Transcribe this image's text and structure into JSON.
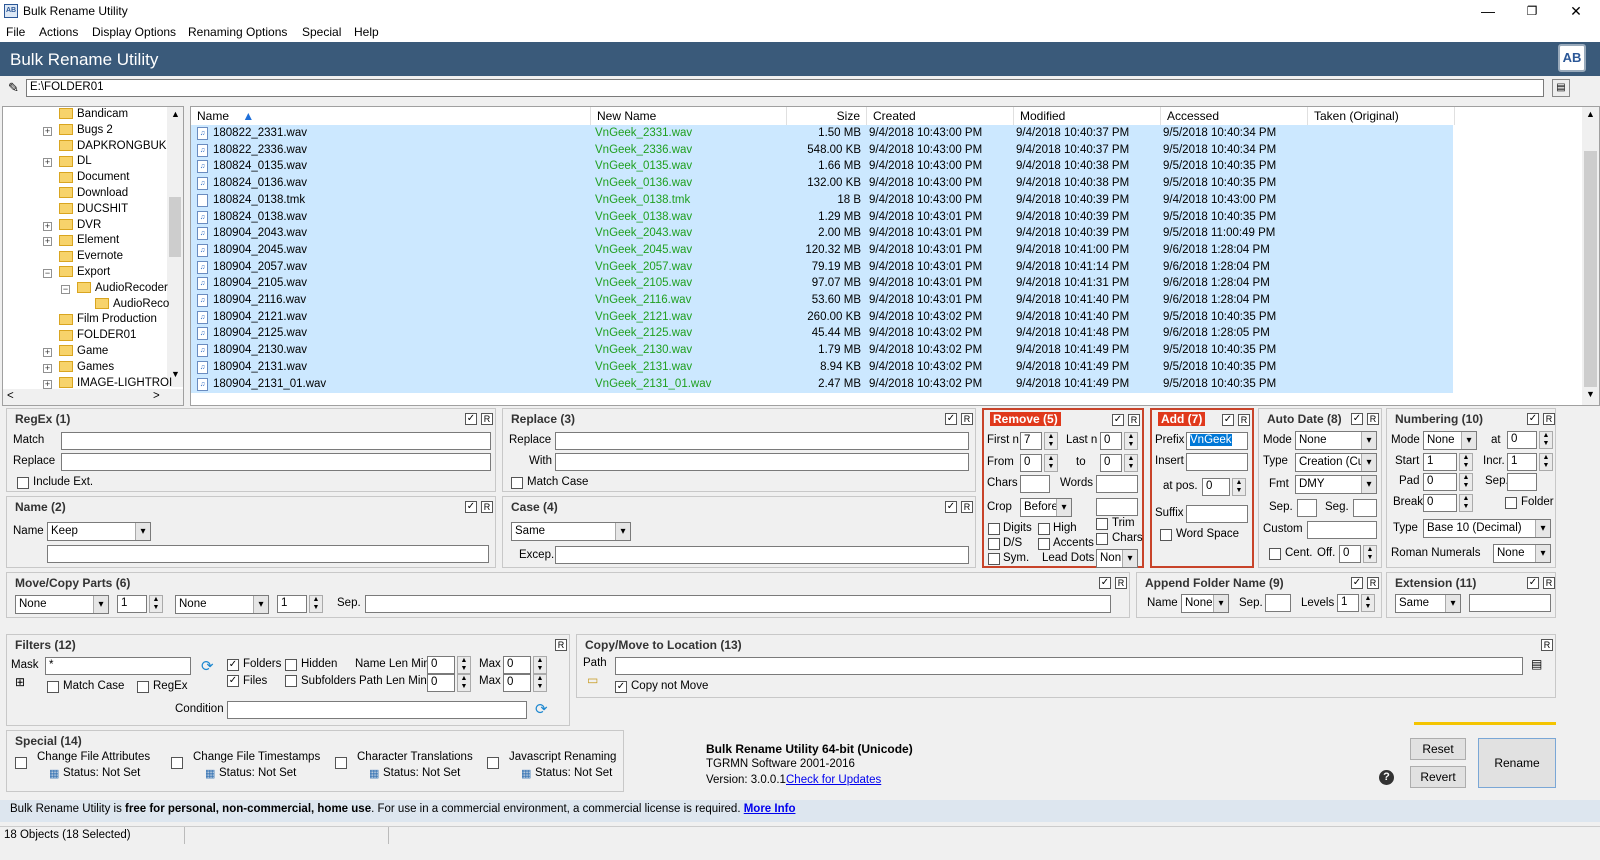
{
  "window": {
    "title": "Bulk Rename Utility",
    "minimize": "—",
    "maximize": "❐",
    "close": "✕"
  },
  "menu": [
    "File",
    "Actions",
    "Display Options",
    "Renaming Options",
    "Special",
    "Help"
  ],
  "banner": {
    "title": "Bulk Rename Utility",
    "logo": "AB"
  },
  "path": "E:\\FOLDER01",
  "tree": [
    {
      "label": "Bandicam",
      "exp": ""
    },
    {
      "label": "Bugs 2",
      "exp": "+"
    },
    {
      "label": "DAPKRONGBUK",
      "exp": ""
    },
    {
      "label": "DL",
      "exp": "+"
    },
    {
      "label": "Document",
      "exp": ""
    },
    {
      "label": "Download",
      "exp": ""
    },
    {
      "label": "DUCSHIT",
      "exp": ""
    },
    {
      "label": "DVR",
      "exp": "+"
    },
    {
      "label": "Element",
      "exp": "+"
    },
    {
      "label": "Evernote",
      "exp": ""
    },
    {
      "label": "Export",
      "exp": "−"
    },
    {
      "label": "AudioRecoder",
      "exp": "−"
    },
    {
      "label": "AudioReco",
      "exp": ""
    },
    {
      "label": "Film Production",
      "exp": ""
    },
    {
      "label": "FOLDER01",
      "exp": ""
    },
    {
      "label": "Game",
      "exp": "+"
    },
    {
      "label": "Games",
      "exp": "+"
    },
    {
      "label": "IMAGE-LIGHTROI",
      "exp": "+"
    }
  ],
  "columns": {
    "name": "Name",
    "new_name": "New Name",
    "size": "Size",
    "created": "Created",
    "modified": "Modified",
    "accessed": "Accessed",
    "taken": "Taken (Original)"
  },
  "files": [
    {
      "name": "180822_2331.wav",
      "new": "VnGeek_2331.wav",
      "size": "1.50 MB",
      "created": "9/4/2018 10:43:00 PM",
      "modified": "9/4/2018 10:40:37 PM",
      "accessed": "9/5/2018 10:40:34 PM"
    },
    {
      "name": "180822_2336.wav",
      "new": "VnGeek_2336.wav",
      "size": "548.00 KB",
      "created": "9/4/2018 10:43:00 PM",
      "modified": "9/4/2018 10:40:37 PM",
      "accessed": "9/5/2018 10:40:34 PM"
    },
    {
      "name": "180824_0135.wav",
      "new": "VnGeek_0135.wav",
      "size": "1.66 MB",
      "created": "9/4/2018 10:43:00 PM",
      "modified": "9/4/2018 10:40:38 PM",
      "accessed": "9/5/2018 10:40:35 PM"
    },
    {
      "name": "180824_0136.wav",
      "new": "VnGeek_0136.wav",
      "size": "132.00 KB",
      "created": "9/4/2018 10:43:00 PM",
      "modified": "9/4/2018 10:40:38 PM",
      "accessed": "9/5/2018 10:40:35 PM"
    },
    {
      "name": "180824_0138.tmk",
      "new": "VnGeek_0138.tmk",
      "size": "18 B",
      "created": "9/4/2018 10:43:00 PM",
      "modified": "9/4/2018 10:40:39 PM",
      "accessed": "9/4/2018 10:43:00 PM"
    },
    {
      "name": "180824_0138.wav",
      "new": "VnGeek_0138.wav",
      "size": "1.29 MB",
      "created": "9/4/2018 10:43:01 PM",
      "modified": "9/4/2018 10:40:39 PM",
      "accessed": "9/5/2018 10:40:35 PM"
    },
    {
      "name": "180904_2043.wav",
      "new": "VnGeek_2043.wav",
      "size": "2.00 MB",
      "created": "9/4/2018 10:43:01 PM",
      "modified": "9/4/2018 10:40:39 PM",
      "accessed": "9/5/2018 11:00:49 PM"
    },
    {
      "name": "180904_2045.wav",
      "new": "VnGeek_2045.wav",
      "size": "120.32 MB",
      "created": "9/4/2018 10:43:01 PM",
      "modified": "9/4/2018 10:41:00 PM",
      "accessed": "9/6/2018 1:28:04 PM"
    },
    {
      "name": "180904_2057.wav",
      "new": "VnGeek_2057.wav",
      "size": "79.19 MB",
      "created": "9/4/2018 10:43:01 PM",
      "modified": "9/4/2018 10:41:14 PM",
      "accessed": "9/6/2018 1:28:04 PM"
    },
    {
      "name": "180904_2105.wav",
      "new": "VnGeek_2105.wav",
      "size": "97.07 MB",
      "created": "9/4/2018 10:43:01 PM",
      "modified": "9/4/2018 10:41:31 PM",
      "accessed": "9/6/2018 1:28:04 PM"
    },
    {
      "name": "180904_2116.wav",
      "new": "VnGeek_2116.wav",
      "size": "53.60 MB",
      "created": "9/4/2018 10:43:01 PM",
      "modified": "9/4/2018 10:41:40 PM",
      "accessed": "9/6/2018 1:28:04 PM"
    },
    {
      "name": "180904_2121.wav",
      "new": "VnGeek_2121.wav",
      "size": "260.00 KB",
      "created": "9/4/2018 10:43:02 PM",
      "modified": "9/4/2018 10:41:40 PM",
      "accessed": "9/5/2018 10:40:35 PM"
    },
    {
      "name": "180904_2125.wav",
      "new": "VnGeek_2125.wav",
      "size": "45.44 MB",
      "created": "9/4/2018 10:43:02 PM",
      "modified": "9/4/2018 10:41:48 PM",
      "accessed": "9/6/2018 1:28:05 PM"
    },
    {
      "name": "180904_2130.wav",
      "new": "VnGeek_2130.wav",
      "size": "1.79 MB",
      "created": "9/4/2018 10:43:02 PM",
      "modified": "9/4/2018 10:41:49 PM",
      "accessed": "9/5/2018 10:40:35 PM"
    },
    {
      "name": "180904_2131.wav",
      "new": "VnGeek_2131.wav",
      "size": "8.94 KB",
      "created": "9/4/2018 10:43:02 PM",
      "modified": "9/4/2018 10:41:49 PM",
      "accessed": "9/5/2018 10:40:35 PM"
    },
    {
      "name": "180904_2131_01.wav",
      "new": "VnGeek_2131_01.wav",
      "size": "2.47 MB",
      "created": "9/4/2018 10:43:02 PM",
      "modified": "9/4/2018 10:41:49 PM",
      "accessed": "9/5/2018 10:40:35 PM"
    }
  ],
  "regex": {
    "title": "RegEx (1)",
    "match": "Match",
    "replace": "Replace",
    "include_ext": "Include Ext."
  },
  "replace": {
    "title": "Replace (3)",
    "replace": "Replace",
    "with": "With",
    "match_case": "Match Case"
  },
  "remove": {
    "title": "Remove (5)",
    "first_n": "First n",
    "first_n_val": "7",
    "last_n": "Last n",
    "last_n_val": "0",
    "from": "From",
    "from_val": "0",
    "to": "to",
    "to_val": "0",
    "chars": "Chars",
    "words": "Words",
    "crop": "Crop",
    "crop_val": "Before",
    "trim": "Trim",
    "chars2": "Chars",
    "digits": "Digits",
    "high": "High",
    "ds": "D/S",
    "accents": "Accents",
    "sym": "Sym.",
    "lead_dots": "Lead Dots",
    "non": "Non"
  },
  "add": {
    "title": "Add (7)",
    "prefix": "Prefix",
    "prefix_val": "VnGeek",
    "insert": "Insert",
    "at_pos": "at pos.",
    "at_pos_val": "0",
    "suffix": "Suffix",
    "word_space": "Word Space"
  },
  "autodate": {
    "title": "Auto Date (8)",
    "mode": "Mode",
    "mode_val": "None",
    "type": "Type",
    "type_val": "Creation (Cur",
    "fmt": "Fmt",
    "fmt_val": "DMY",
    "sep": "Sep.",
    "seg": "Seg.",
    "custom": "Custom",
    "cent": "Cent.",
    "off": "Off.",
    "off_val": "0"
  },
  "numbering": {
    "title": "Numbering (10)",
    "mode": "Mode",
    "mode_val": "None",
    "at": "at",
    "at_val": "0",
    "start": "Start",
    "start_val": "1",
    "incr": "Incr.",
    "incr_val": "1",
    "pad": "Pad",
    "pad_val": "0",
    "sep": "Sep.",
    "break": "Break",
    "break_val": "0",
    "folder": "Folder",
    "type": "Type",
    "type_val": "Base 10 (Decimal)",
    "roman": "Roman Numerals",
    "roman_val": "None"
  },
  "name": {
    "title": "Name (2)",
    "name": "Name",
    "name_val": "Keep"
  },
  "case": {
    "title": "Case (4)",
    "case_val": "Same",
    "excep": "Excep."
  },
  "movecopy": {
    "title": "Move/Copy Parts (6)",
    "a": "None",
    "a_n": "1",
    "b": "None",
    "b_n": "1",
    "sep": "Sep."
  },
  "appendfolder": {
    "title": "Append Folder Name (9)",
    "name": "Name",
    "name_val": "None",
    "sep": "Sep.",
    "levels": "Levels",
    "levels_val": "1"
  },
  "extension": {
    "title": "Extension (11)",
    "val": "Same"
  },
  "filters": {
    "title": "Filters (12)",
    "mask": "Mask",
    "mask_val": "*",
    "folders": "Folders",
    "hidden": "Hidden",
    "files": "Files",
    "subfolders": "Subfolders",
    "name_len_min": "Name Len Min",
    "name_min_val": "0",
    "max": "Max",
    "name_max_val": "0",
    "path_len_min": "Path Len Min",
    "path_min_val": "0",
    "path_max_val": "0",
    "match_case": "Match Case",
    "regex": "RegEx",
    "condition": "Condition"
  },
  "copymove": {
    "title": "Copy/Move to Location (13)",
    "path": "Path",
    "copy_not_move": "Copy not Move"
  },
  "special": {
    "title": "Special (14)",
    "items": [
      {
        "label": "Change File Attributes",
        "status": "Status: Not Set"
      },
      {
        "label": "Change File Timestamps",
        "status": "Status: Not Set"
      },
      {
        "label": "Character Translations",
        "status": "Status: Not Set"
      },
      {
        "label": "Javascript Renaming",
        "status": "Status: Not Set"
      }
    ]
  },
  "about": {
    "line1": "Bulk Rename Utility 64-bit (Unicode)",
    "line2": "TGRMN Software 2001-2016",
    "version": "Version: 3.0.0.1",
    "check": "Check for Updates"
  },
  "buttons": {
    "reset": "Reset",
    "revert": "Revert",
    "rename": "Rename",
    "help": "?"
  },
  "footer": {
    "pre": "Bulk Rename Utility is ",
    "bold": "free for personal, non-commercial, home use",
    "post": ". For use in a commercial environment, a commercial license is required. ",
    "link": "More Info"
  },
  "status": "18 Objects (18 Selected)"
}
